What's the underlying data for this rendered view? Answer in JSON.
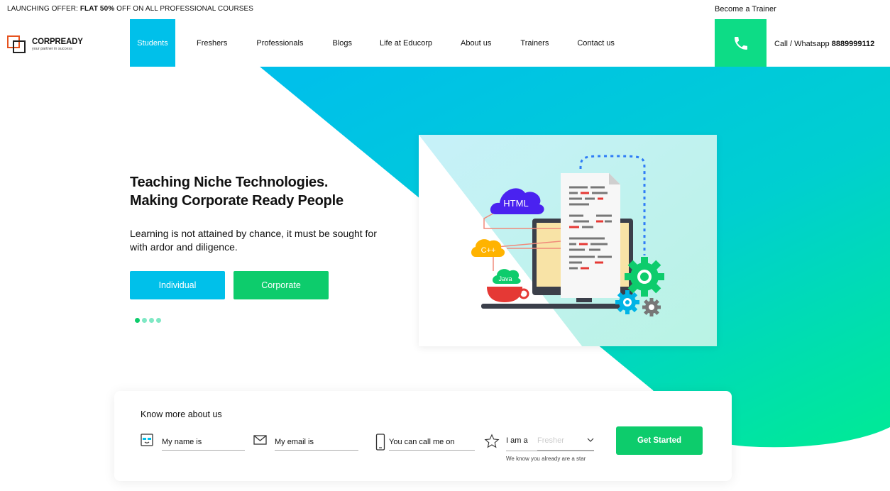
{
  "top_bar": {
    "offer_prefix": "LAUNCHING OFFER: ",
    "offer_highlight": "FLAT 50%",
    "offer_suffix": " OFF ON ALL PROFESSIONAL COURSES",
    "become_trainer": "Become a Trainer"
  },
  "brand": {
    "name": "CORPREADY",
    "tagline": "your partner in success"
  },
  "nav": {
    "items": [
      {
        "label": "Students",
        "active": true
      },
      {
        "label": "Freshers"
      },
      {
        "label": "Professionals"
      },
      {
        "label": "Blogs"
      },
      {
        "label": "Life at Educorp"
      },
      {
        "label": "About us"
      },
      {
        "label": "Trainers"
      },
      {
        "label": "Contact us"
      }
    ]
  },
  "contact": {
    "call_label": "Call / Whatsapp ",
    "phone_number": "8889999112",
    "phone_icon": "phone-icon"
  },
  "hero": {
    "title_line1": "Teaching Niche Technologies.",
    "title_line2": "Making Corporate Ready People",
    "subtitle": "Learning is not attained by chance, it must be sought for with ardor and diligence.",
    "buttons": {
      "individual": "Individual",
      "corporate": "Corporate"
    },
    "carousel": {
      "slide_count": 4,
      "active_index": 0
    },
    "illustration": {
      "bubbles": [
        "HTML",
        "C++",
        "Java"
      ]
    }
  },
  "form": {
    "title": "Know more about us",
    "name_placeholder": "My name is",
    "email_placeholder": "My email is",
    "phone_placeholder": "You can call me on",
    "iam_label": "I am a",
    "iam_value": "Fresher",
    "note": "We know you already are a star",
    "submit": "Get Started"
  },
  "colors": {
    "cyan": "#00c0ea",
    "green": "#0dcc6c",
    "phone_green": "#0ddc86",
    "accent_orange": "#e6531f"
  }
}
